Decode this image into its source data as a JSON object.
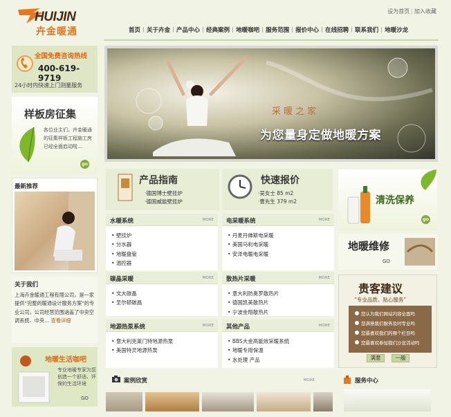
{
  "header": {
    "logo_text": "HUIJIN",
    "logo_cn": "卉金暖通",
    "toplinks": [
      "设为首页",
      "加入收藏"
    ],
    "nav": [
      "首页",
      "关于卉金",
      "产品中心",
      "经典案例",
      "地暖咖吧",
      "服务范围",
      "报价中心",
      "在线招聘",
      "联系我们",
      "地暖沙龙"
    ]
  },
  "hotline": {
    "title": "全国免费咨询热线",
    "phone": "400-619-9719",
    "note": "24小时内快速上门测量服务"
  },
  "model_room": {
    "title": "样板房征集",
    "text": "各位业主们，卉金暖通的征集样板工程施工房已经全面启动啦…",
    "go": "go"
  },
  "recommend": {
    "title": "最新推荐"
  },
  "about": {
    "title": "关于我们",
    "text": "上海卉金暖通工程有限公司，是一家提供“完整的暖通设计服务方案”的专业公司，公司经营范围涵盖了中央空调系统、中央…",
    "more": "查看详细"
  },
  "life": {
    "title": "地暖生活咖吧",
    "text": "专业地暖专家为您创造一个舒适、环保的生活环境",
    "go": "GO"
  },
  "banner": {
    "script": "采暖之家",
    "slogan": "为您量身定做地暖方案"
  },
  "product_guide": {
    "title": "产品指南",
    "items": [
      "·德国博士壁挂炉",
      "·德国威能壁挂炉"
    ]
  },
  "quick_quote": {
    "title": "快速报价",
    "items": [
      "·吴女士 85 m2",
      "·曹先生 379 m2"
    ]
  },
  "boxes": [
    {
      "title": "水暖系统",
      "more": "MORE",
      "items": [
        "壁挂炉",
        "分水器",
        "地暖盘管",
        "温控器"
      ]
    },
    {
      "title": "电采暖系统",
      "more": "MORE",
      "items": [
        "丹麦丹佛斯电采暖",
        "美国马利电采暖",
        "安泽电暖电采暖"
      ]
    },
    {
      "title": "碳晶采暖",
      "more": "MORE",
      "items": [
        "文大碳晶",
        "圣尔顿碳晶"
      ]
    },
    {
      "title": "散热片采暖",
      "more": "MORE",
      "items": [
        "意大利防奥罗散热片",
        "德国凯美散热片",
        "宁波金翔散热片"
      ]
    },
    {
      "title": "地源热泵系统",
      "more": "MORE",
      "items": [
        "意大利克莱门特地源热泵",
        "美国特灵地源热泵"
      ]
    },
    {
      "title": "其他产品",
      "more": "MORE",
      "items": [
        "BBS大金高能效采暖系统",
        "地暖专用保温",
        "水处理 产品"
      ]
    }
  ],
  "clean": {
    "title": "清洗保养",
    "go": "go"
  },
  "repair": {
    "title": "地暖维修",
    "go": "GO"
  },
  "advice": {
    "title": "贵客建议",
    "subtitle": "“专业品质、贴心服务”",
    "options": [
      "您认为我们网站内容全面吗",
      "您满意我们服务及时专业吗",
      "您最喜欢我们的哪个栏目吗",
      "您最喜欢参加我们沙龙活动吗"
    ],
    "buttons": [
      "满意",
      "一般"
    ]
  },
  "cases": {
    "title": "案例欣赏",
    "more": "MORE"
  },
  "service": {
    "title": "服务中心"
  }
}
